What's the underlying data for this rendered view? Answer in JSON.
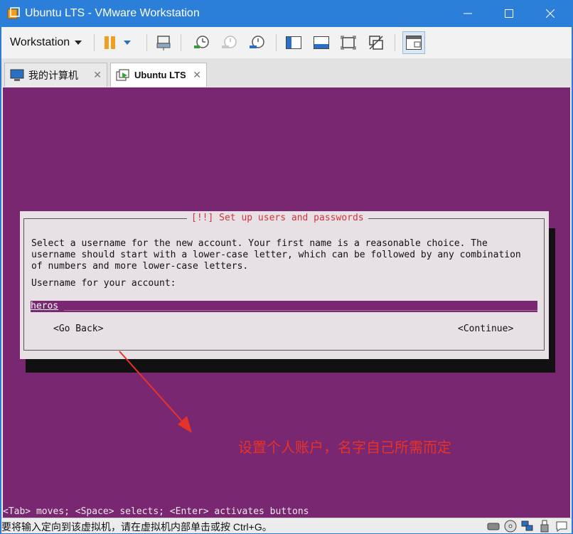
{
  "window": {
    "title": "Ubuntu LTS - VMware Workstation",
    "min_icon": "minimize-icon",
    "max_icon": "maximize-icon",
    "close_icon": "close-icon"
  },
  "toolbar": {
    "menu_label": "Workstation",
    "icons": [
      "pause-icon",
      "dropdown-icon",
      "send-keys-icon",
      "snapshot-take-icon",
      "snapshot-revert-icon",
      "snapshot-manager-icon",
      "sidebar-icon",
      "console-view-icon",
      "fullscreen-icon",
      "unity-icon",
      "thumbnail-icon"
    ]
  },
  "tabs": [
    {
      "label": "我的计算机",
      "icon": "computer-icon"
    },
    {
      "label": "Ubuntu LTS",
      "icon": "vm-running-icon"
    }
  ],
  "installer": {
    "title": "[!!] Set up users and passwords",
    "description": "Select a username for the new account. Your first name is a reasonable choice. The\nusername should start with a lower-case letter, which can be followed by any combination\nof numbers and more lower-case letters.",
    "field_label": "Username for your account:",
    "username_value": "heros",
    "go_back": "<Go Back>",
    "continue": "<Continue>",
    "hint": "<Tab> moves; <Space> selects; <Enter> activates buttons"
  },
  "annotation": {
    "text": "设置个人账户，名字自己所需而定",
    "color": "#e63329"
  },
  "status": {
    "message": "要将输入定向到该虚拟机，请在虚拟机内部单击或按 Ctrl+G。",
    "icons": [
      "hard-disk-icon",
      "cd-icon",
      "network-icon",
      "usb-icon",
      "message-icon"
    ]
  },
  "colors": {
    "titlebar": "#2b7fd8",
    "guest_bg": "#782770",
    "dialog_bg": "#e7e1e6",
    "dialog_title": "#d2333c"
  }
}
